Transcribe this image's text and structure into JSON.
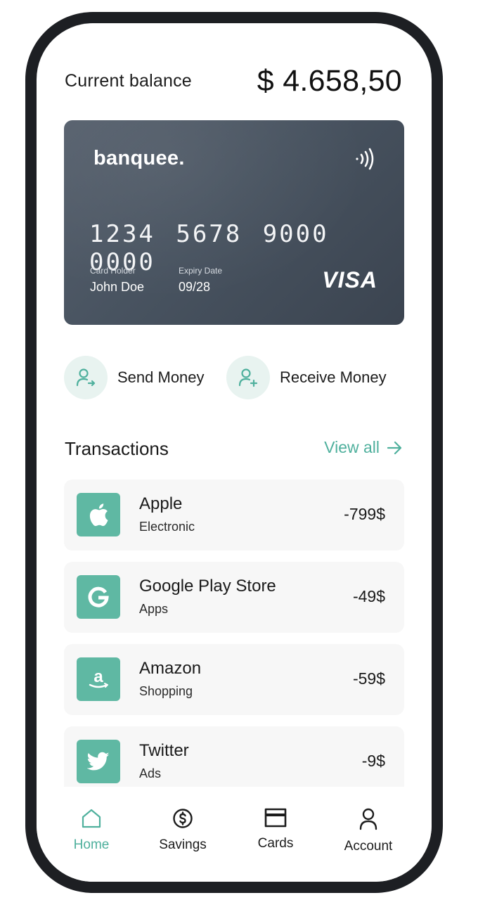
{
  "balance": {
    "label": "Current balance",
    "amount": "$ 4.658,50"
  },
  "card": {
    "brand": "banquee.",
    "number": "1234 5678 9000 0000",
    "holder_label": "Card Holder",
    "holder_name": "John Doe",
    "expiry_label": "Expiry Date",
    "expiry_date": "09/28",
    "network": "VISA",
    "contactless_icon": "nfc-icon"
  },
  "actions": [
    {
      "label": "Send Money",
      "icon": "user-send-icon"
    },
    {
      "label": "Receive Money",
      "icon": "user-receive-icon"
    }
  ],
  "transactions": {
    "title": "Transactions",
    "view_all": "View all",
    "items": [
      {
        "name": "Apple",
        "category": "Electronic",
        "amount": "-799$",
        "icon": "apple-icon"
      },
      {
        "name": "Google Play Store",
        "category": "Apps",
        "amount": "-49$",
        "icon": "google-icon"
      },
      {
        "name": "Amazon",
        "category": "Shopping",
        "amount": "-59$",
        "icon": "amazon-icon"
      },
      {
        "name": "Twitter",
        "category": "Ads",
        "amount": "-9$",
        "icon": "twitter-icon"
      }
    ]
  },
  "nav": {
    "items": [
      {
        "label": "Home",
        "icon": "home-icon",
        "active": true
      },
      {
        "label": "Savings",
        "icon": "dollar-circle-icon",
        "active": false
      },
      {
        "label": "Cards",
        "icon": "card-icon",
        "active": false
      },
      {
        "label": "Account",
        "icon": "user-icon",
        "active": false
      }
    ]
  },
  "colors": {
    "accent": "#4fb09d",
    "icon_tile": "#5fb8a3",
    "action_bg": "#e8f3f0",
    "card_bg": "#4a5461",
    "frame": "#1d1f23"
  }
}
